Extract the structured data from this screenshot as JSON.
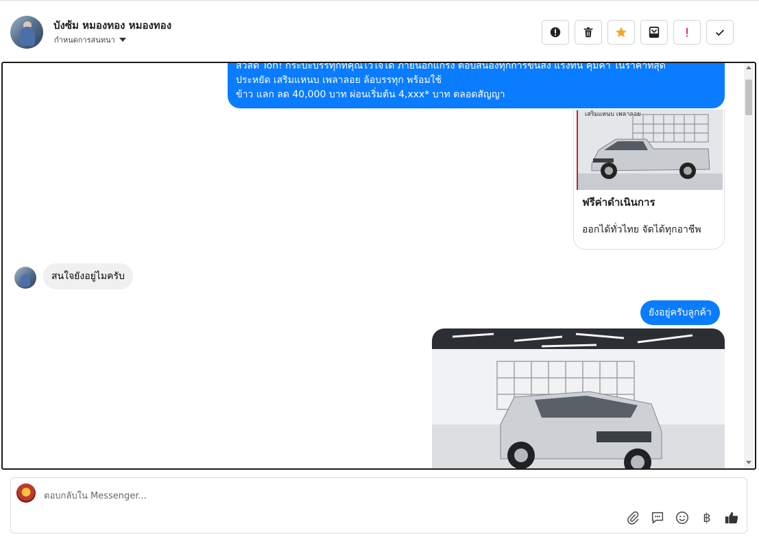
{
  "header": {
    "contact_name": "บังซ้ม หมองทอง หมองทอง",
    "assign_label": "กำหนดการสนทนา",
    "actions": [
      {
        "name": "report-spam",
        "icon": "alert-circle-icon"
      },
      {
        "name": "delete",
        "icon": "trash-icon"
      },
      {
        "name": "star",
        "icon": "star-icon",
        "color": "#f5a623"
      },
      {
        "name": "archive",
        "icon": "archive-icon"
      },
      {
        "name": "mark-important",
        "icon": "exclamation-icon",
        "color": "#e0245e"
      },
      {
        "name": "mark-done",
        "icon": "check-icon"
      }
    ]
  },
  "messages": {
    "outgoing_long": {
      "line1": "สวัสดี Ton! กระบะบรรทุกที่คุณไว้ใจได้ ภายนอกแกร่ง ตอบสนองทุกการขนส่ง แรงทน คุ้มค่า ในราคาที่สุด",
      "line2": "ประหยัด เสริมแหนบ เพลาลอย ล้อบรรทุก พร้อมใช้",
      "line3": "ข้าว แลก ลด 40,000 บาท ผ่อนเริ่มต้น 4,xxx* บาท ตลอดสัญญา"
    },
    "card": {
      "image_caption": "เสริมแหนบ เพลาลอย",
      "title": "ฟรีค่าดำเนินการ",
      "subtitle": "ออกได้ทั่วไทย จัดได้ทุกอาชีพ"
    },
    "incoming": "สนใจยังอยู่ไมครับ",
    "outgoing_reply": "ยังอยู่ครับลูกค้า"
  },
  "composer": {
    "placeholder": "ตอบกลับใน Messenger...",
    "tools": [
      "paperclip-icon",
      "chat-bubble-icon",
      "smiley-icon",
      "baht-icon",
      "thumbs-up-icon"
    ],
    "baht_symbol": "฿"
  },
  "colors": {
    "accent": "#0a7cff",
    "incoming_bubble": "#f0f0f0",
    "star": "#f5a623",
    "important": "#e0245e"
  }
}
